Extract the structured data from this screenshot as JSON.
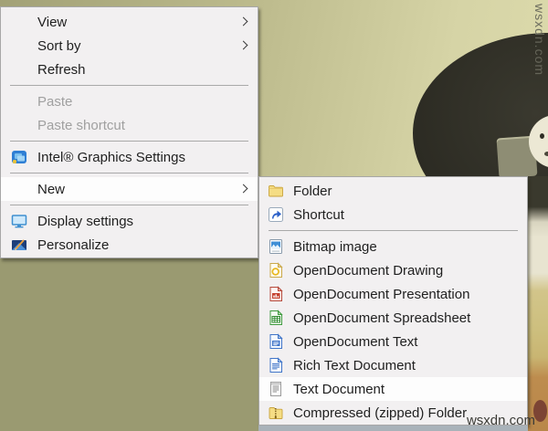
{
  "watermarks": {
    "top_right": "wsxdn.com",
    "bottom_right": "wsxdn.com"
  },
  "main_menu": {
    "items": [
      {
        "label": "View",
        "has_submenu": true
      },
      {
        "label": "Sort by",
        "has_submenu": true
      },
      {
        "label": "Refresh"
      },
      {
        "label": "Paste",
        "disabled": true
      },
      {
        "label": "Paste shortcut",
        "disabled": true
      },
      {
        "label": "Intel® Graphics Settings",
        "icon": "intel-graphics-icon"
      },
      {
        "label": "New",
        "has_submenu": true,
        "highlighted": true
      },
      {
        "label": "Display settings",
        "icon": "display-settings-icon"
      },
      {
        "label": "Personalize",
        "icon": "personalize-icon"
      }
    ]
  },
  "submenu": {
    "items": [
      {
        "label": "Folder",
        "icon": "folder-icon"
      },
      {
        "label": "Shortcut",
        "icon": "shortcut-icon"
      },
      {
        "label": "Bitmap image",
        "icon": "bitmap-image-icon"
      },
      {
        "label": "OpenDocument Drawing",
        "icon": "od-drawing-icon"
      },
      {
        "label": "OpenDocument Presentation",
        "icon": "od-presentation-icon"
      },
      {
        "label": "OpenDocument Spreadsheet",
        "icon": "od-spreadsheet-icon"
      },
      {
        "label": "OpenDocument Text",
        "icon": "od-text-icon"
      },
      {
        "label": "Rich Text Document",
        "icon": "rich-text-icon"
      },
      {
        "label": "Text Document",
        "icon": "text-document-icon",
        "highlighted": true
      },
      {
        "label": "Compressed (zipped) Folder",
        "icon": "compressed-folder-icon"
      }
    ]
  },
  "colors": {
    "menu_bg": "#f2f0f1",
    "menu_border": "#a7a7a7",
    "highlight": "#fdfdfd",
    "text": "#1f1f1f",
    "disabled_text": "#a0a0a0",
    "wallpaper_olive": "#9a9a71",
    "wallpaper_light": "#d6d4a6"
  }
}
